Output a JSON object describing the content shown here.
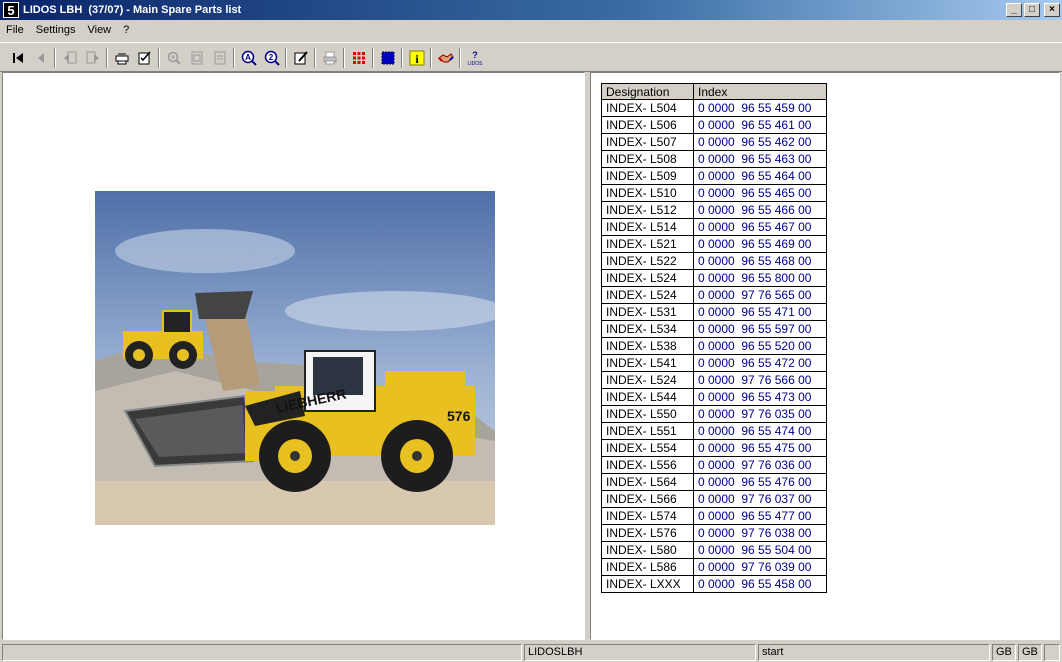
{
  "window": {
    "title": "LIDOS LBH  (37/07) - Main Spare Parts list",
    "app_icon_glyph": "5"
  },
  "menu": [
    "File",
    "Settings",
    "View",
    "?"
  ],
  "toolbar": {
    "buttons": [
      "first-page",
      "previous-page",
      "back-arrow",
      "forward-arrow",
      "print-preview",
      "checklist",
      "zoom-in",
      "fit-page",
      "fit-width",
      "search-a",
      "search-2",
      "edit-note",
      "printer",
      "red-grid",
      "blue-square",
      "info",
      "handshake",
      "lidos-help"
    ]
  },
  "table": {
    "headers": [
      "Designation",
      "Index"
    ],
    "rows": [
      [
        "INDEX- L504",
        "0 0000  96 55 459 00"
      ],
      [
        "INDEX- L506",
        "0 0000  96 55 461 00"
      ],
      [
        "INDEX- L507",
        "0 0000  96 55 462 00"
      ],
      [
        "INDEX- L508",
        "0 0000  96 55 463 00"
      ],
      [
        "INDEX- L509",
        "0 0000  96 55 464 00"
      ],
      [
        "INDEX- L510",
        "0 0000  96 55 465 00"
      ],
      [
        "INDEX- L512",
        "0 0000  96 55 466 00"
      ],
      [
        "INDEX- L514",
        "0 0000  96 55 467 00"
      ],
      [
        "INDEX- L521",
        "0 0000  96 55 469 00"
      ],
      [
        "INDEX- L522",
        "0 0000  96 55 468 00"
      ],
      [
        "INDEX- L524",
        "0 0000  96 55 800 00"
      ],
      [
        "INDEX- L524",
        "0 0000  97 76 565 00"
      ],
      [
        "INDEX- L531",
        "0 0000  96 55 471 00"
      ],
      [
        "INDEX- L534",
        "0 0000  96 55 597 00"
      ],
      [
        "INDEX- L538",
        "0 0000  96 55 520 00"
      ],
      [
        "INDEX- L541",
        "0 0000  96 55 472 00"
      ],
      [
        "INDEX- L524",
        "0 0000  97 76 566 00"
      ],
      [
        "INDEX- L544",
        "0 0000  96 55 473 00"
      ],
      [
        "INDEX- L550",
        "0 0000  97 76 035 00"
      ],
      [
        "INDEX- L551",
        "0 0000  96 55 474 00"
      ],
      [
        "INDEX- L554",
        "0 0000  96 55 475 00"
      ],
      [
        "INDEX- L556",
        "0 0000  97 76 036 00"
      ],
      [
        "INDEX- L564",
        "0 0000  96 55 476 00"
      ],
      [
        "INDEX- L566",
        "0 0000  97 76 037 00"
      ],
      [
        "INDEX- L574",
        "0 0000  96 55 477 00"
      ],
      [
        "INDEX- L576",
        "0 0000  97 76 038 00"
      ],
      [
        "INDEX- L580",
        "0 0000  96 55 504 00"
      ],
      [
        "INDEX- L586",
        "0 0000  97 76 039 00"
      ],
      [
        "INDEX- LXXX",
        "0 0000  96 55 458 00"
      ]
    ]
  },
  "photo": {
    "brand_text": "LIEBHERR",
    "model_text": "576"
  },
  "statusbar": {
    "cell1": "",
    "cell2": "LIDOSLBH",
    "cell3": "start",
    "cell4": "GB",
    "cell5": "GB",
    "cell6": ""
  },
  "colors": {
    "index_text": "#00008b",
    "title_gradient_start": "#0a246a"
  }
}
